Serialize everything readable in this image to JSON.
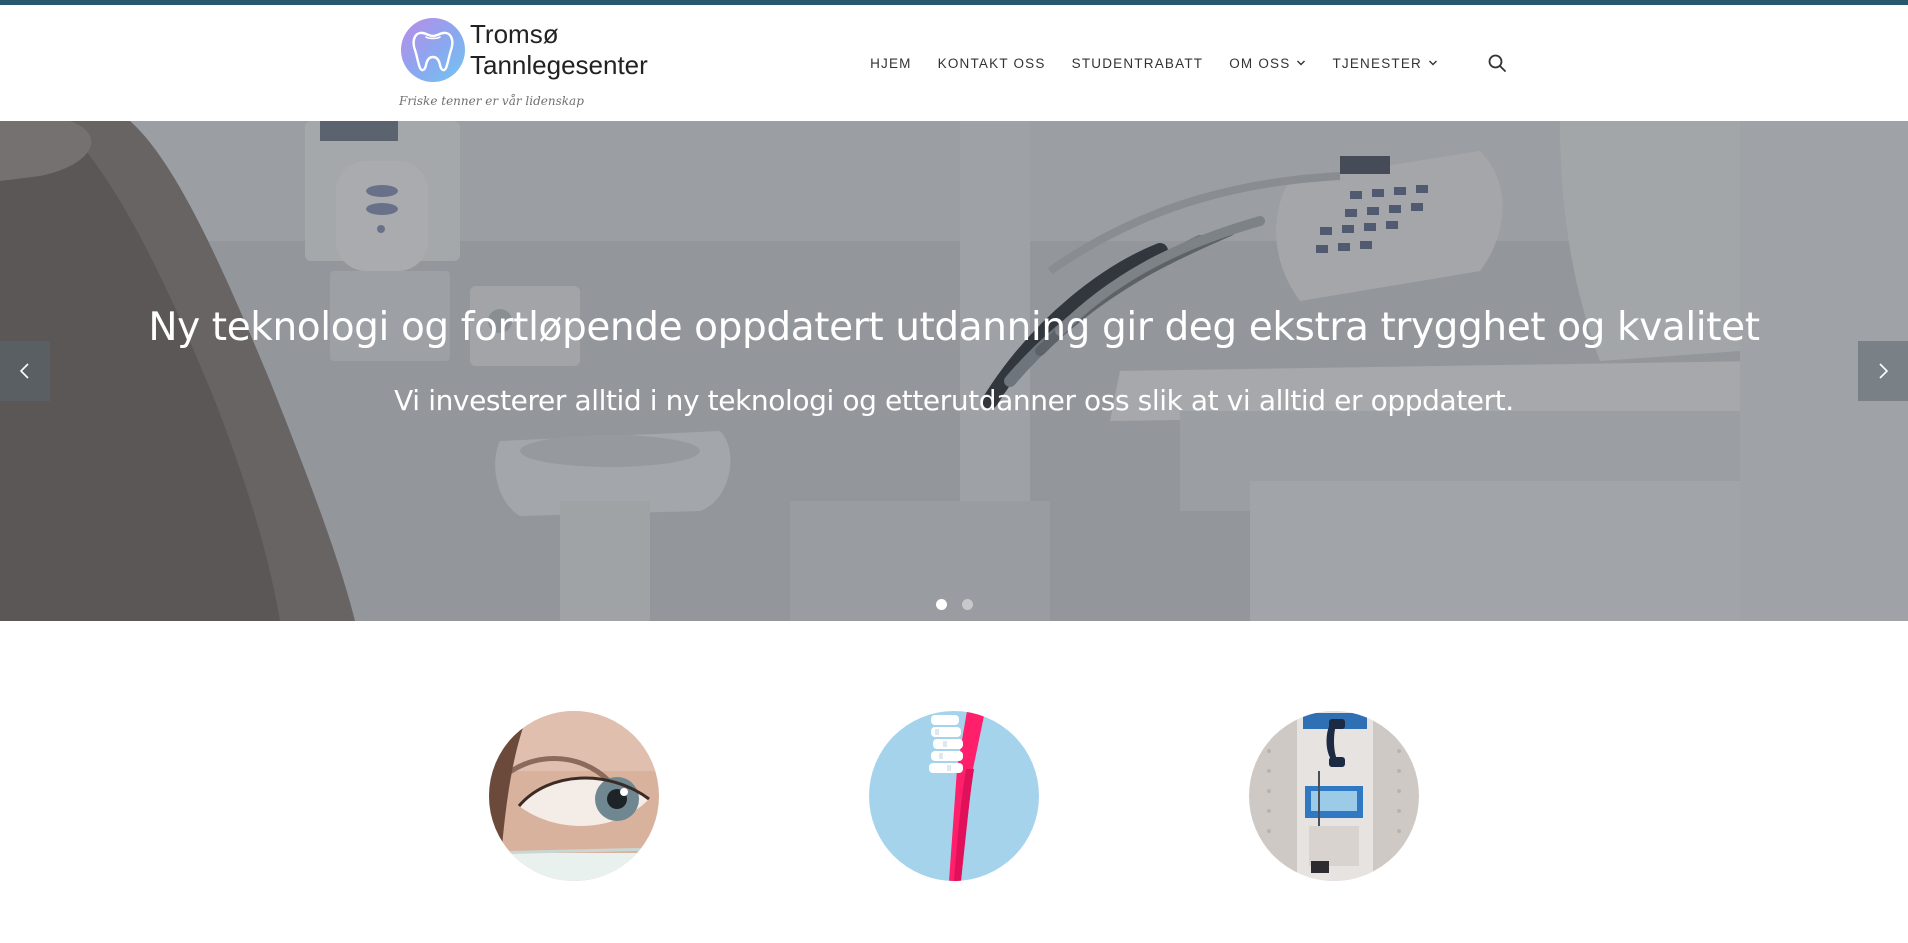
{
  "brand": {
    "name_line1": "Tromsø",
    "name_line2": "Tannlegesenter",
    "tagline": "Friske tenner er vår lidenskap",
    "logo_icon": "tooth-icon"
  },
  "nav": {
    "items": [
      {
        "label": "HJEM",
        "has_dropdown": false
      },
      {
        "label": "KONTAKT OSS",
        "has_dropdown": false
      },
      {
        "label": "STUDENTRABATT",
        "has_dropdown": false
      },
      {
        "label": "OM OSS",
        "has_dropdown": true
      },
      {
        "label": "TJENESTER",
        "has_dropdown": true
      }
    ],
    "search_icon": "search-icon"
  },
  "hero": {
    "title": "Ny teknologi og fortløpende oppdatert utdanning gir deg ekstra trygghet og kvalitet",
    "subtitle": "Vi investerer alltid i ny teknologi og etterutdanner oss slik at vi alltid er oppdatert.",
    "slide_count": 2,
    "active_slide": 1,
    "prev_icon": "chevron-left-icon",
    "next_icon": "chevron-right-icon"
  },
  "features": [
    {
      "image": "eye-and-mask-photo"
    },
    {
      "image": "toothbrush-photo"
    },
    {
      "image": "payphone-photo"
    }
  ],
  "colors": {
    "top_bar": "#27586b",
    "text_dark": "#333333",
    "hero_text": "#ffffff",
    "toothbrush": "#ff1f6b",
    "toothbrush_bg": "#a6d3ec"
  }
}
